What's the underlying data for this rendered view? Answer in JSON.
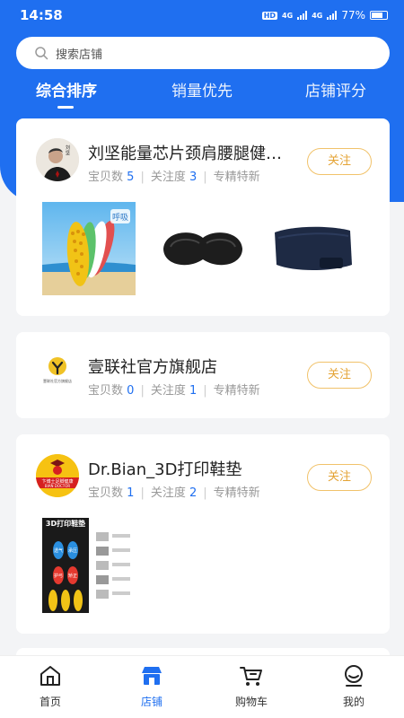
{
  "status_bar": {
    "time": "14:58",
    "hd_label": "HD",
    "net1": "4G",
    "net2": "4G",
    "battery": "77%",
    "battery_level": 0.77
  },
  "search": {
    "placeholder": "搜索店铺"
  },
  "tabs": [
    {
      "label": "综合排序",
      "active": true
    },
    {
      "label": "销量优先",
      "active": false
    },
    {
      "label": "店铺评分",
      "active": false
    }
  ],
  "stores": [
    {
      "name": "刘坚能量芯片颈肩腰腿健…",
      "goods_label": "宝贝数",
      "goods_count": "5",
      "follow_label": "关注度",
      "follow_count": "3",
      "tag": "专精特新",
      "follow_button": "关注"
    },
    {
      "name": "壹联社官方旗舰店",
      "goods_label": "宝贝数",
      "goods_count": "0",
      "follow_label": "关注度",
      "follow_count": "1",
      "tag": "专精特新",
      "follow_button": "关注"
    },
    {
      "name": "Dr.Bian_3D打印鞋垫",
      "goods_label": "宝贝数",
      "goods_count": "1",
      "follow_label": "关注度",
      "follow_count": "2",
      "tag": "专精特新",
      "follow_button": "关注"
    }
  ],
  "logos": {
    "liu_caption": "刘坚",
    "yilianshe_text": "壹联社官方旗舰店",
    "drbian_cn": "卞博士足脚健康",
    "drbian_en": "BIAN DOCTOR"
  },
  "products": {
    "insole_badge": "呼吸",
    "insole3d_title": "3D打印鞋垫",
    "insole3d_tags": [
      "透气",
      "承压",
      "护弓",
      "矫正"
    ]
  },
  "bottom_nav": [
    {
      "label": "首页",
      "icon": "home-icon",
      "active": false
    },
    {
      "label": "店铺",
      "icon": "store-icon",
      "active": true
    },
    {
      "label": "购物车",
      "icon": "cart-icon",
      "active": false
    },
    {
      "label": "我的",
      "icon": "profile-icon",
      "active": false
    }
  ],
  "colors": {
    "primary": "#1f6ff0",
    "follow": "#e4a334",
    "background": "#f3f4f6"
  }
}
